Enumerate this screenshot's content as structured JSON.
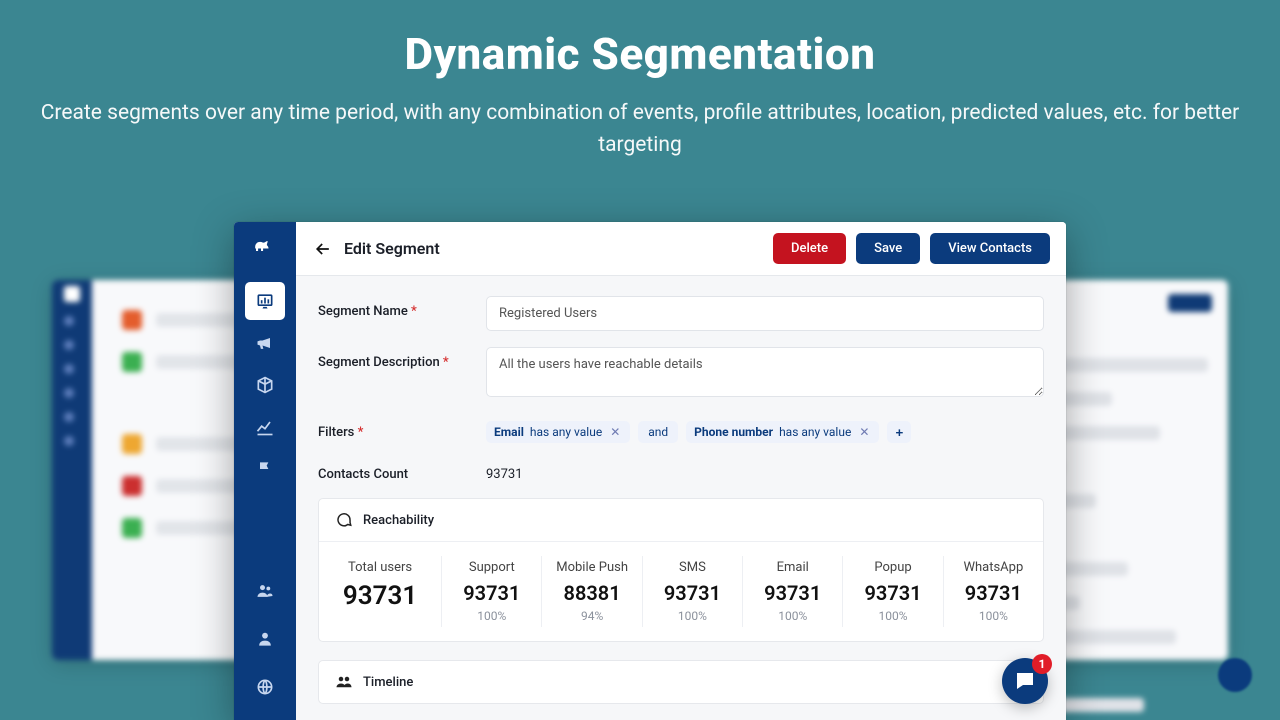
{
  "hero": {
    "title": "Dynamic Segmentation",
    "subtitle": "Create segments over any time period, with any combination of events, profile attributes, location, predicted values, etc. for better targeting"
  },
  "header": {
    "title": "Edit Segment",
    "delete": "Delete",
    "save": "Save",
    "view_contacts": "View Contacts"
  },
  "form": {
    "name_label": "Segment Name",
    "name_value": "Registered Users",
    "desc_label": "Segment Description",
    "desc_value": "All the users have reachable details",
    "filters_label": "Filters",
    "count_label": "Contacts Count",
    "count_value": "93731"
  },
  "filters": {
    "chips": [
      {
        "field": "Email",
        "op": "has any value"
      },
      {
        "field": "Phone number",
        "op": "has any value"
      }
    ],
    "and": "and"
  },
  "reach": {
    "title": "Reachability",
    "total_label": "Total users",
    "total_value": "93731",
    "channels": [
      {
        "name": "Support",
        "value": "93731",
        "pct": "100%"
      },
      {
        "name": "Mobile Push",
        "value": "88381",
        "pct": "94%"
      },
      {
        "name": "SMS",
        "value": "93731",
        "pct": "100%"
      },
      {
        "name": "Email",
        "value": "93731",
        "pct": "100%"
      },
      {
        "name": "Popup",
        "value": "93731",
        "pct": "100%"
      },
      {
        "name": "WhatsApp",
        "value": "93731",
        "pct": "100%"
      }
    ]
  },
  "timeline": {
    "title": "Timeline"
  },
  "chat": {
    "badge": "1"
  },
  "sidebar": {
    "items": [
      {
        "id": "dashboard-icon",
        "active": true
      },
      {
        "id": "campaigns-icon",
        "active": false
      },
      {
        "id": "segments-icon",
        "active": false
      },
      {
        "id": "analytics-icon",
        "active": false
      },
      {
        "id": "automation-icon",
        "active": false
      }
    ]
  }
}
